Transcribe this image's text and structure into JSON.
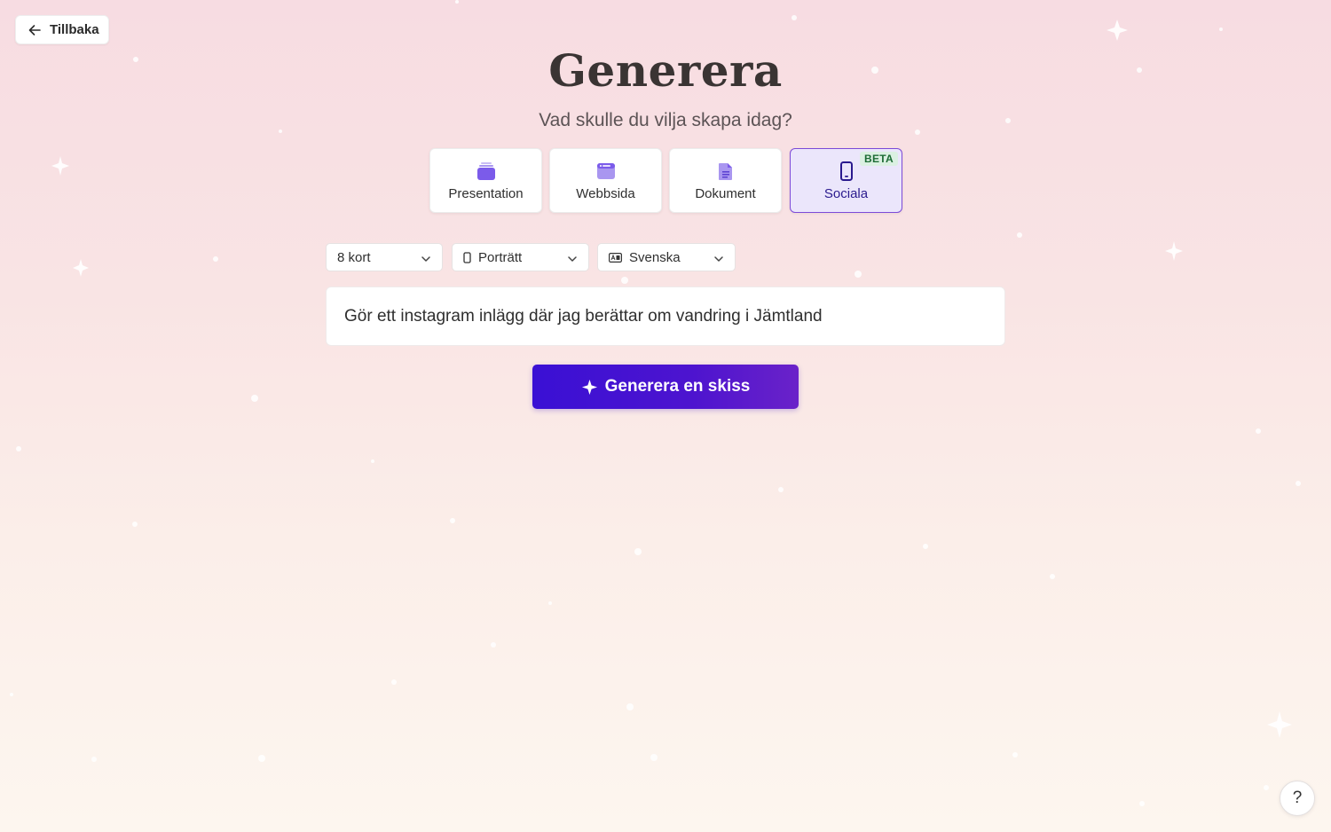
{
  "nav": {
    "back_label": "Tillbaka"
  },
  "header": {
    "title": "Generera",
    "subtitle": "Vad skulle du vilja skapa idag?"
  },
  "types": [
    {
      "label": "Presentation",
      "icon": "presentation-icon"
    },
    {
      "label": "Webbsida",
      "icon": "webpage-icon"
    },
    {
      "label": "Dokument",
      "icon": "document-icon"
    },
    {
      "label": "Sociala",
      "icon": "phone-icon",
      "badge": "BETA",
      "selected": true
    }
  ],
  "options": {
    "cards": "8 kort",
    "orientation": "Porträtt",
    "language": "Svenska"
  },
  "prompt": {
    "value": "Gör ett instagram inlägg där jag berättar om vandring i Jämtland"
  },
  "generate": {
    "label": "Generera en skiss"
  },
  "help": {
    "label": "?"
  },
  "colors": {
    "accent": "#4a12d2",
    "selected_bg": "#ebe6fb",
    "beta_bg": "#dbf0e2",
    "beta_text": "#1d6b35"
  }
}
